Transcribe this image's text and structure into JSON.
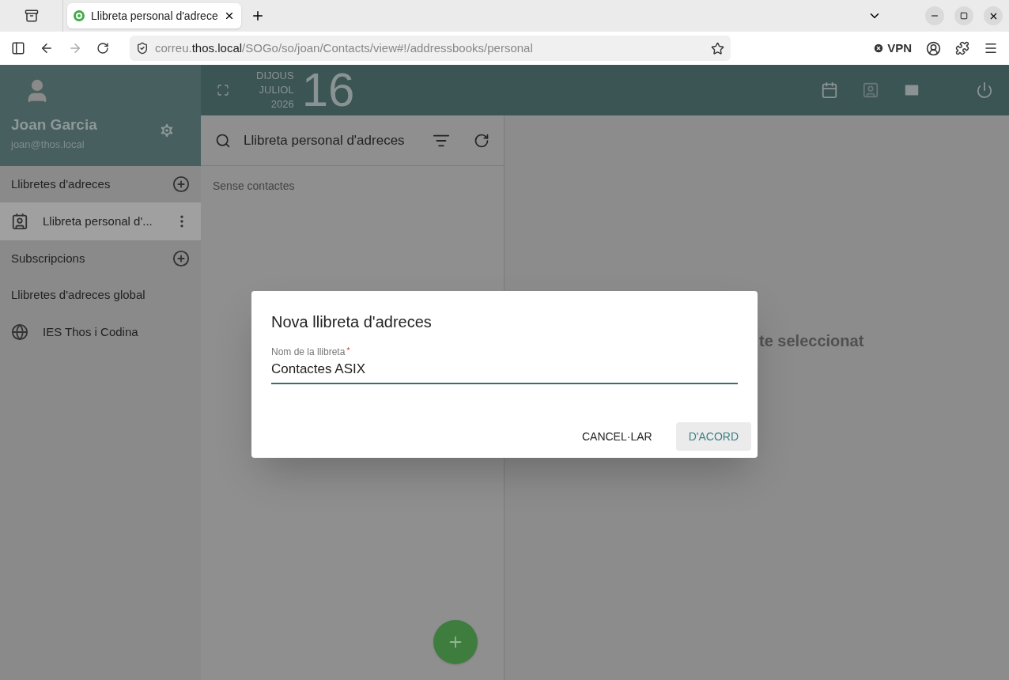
{
  "browser": {
    "tabs": [
      {
        "title": "Llibreta personal d'adrece",
        "selected": true
      }
    ],
    "url": {
      "scheme_host_prefix": "correu.",
      "host": "thos.local",
      "path": "/SOGo/so/joan/Contacts/view#!/addressbooks/personal"
    },
    "vpn": "VPN"
  },
  "user": {
    "name": "Joan Garcia",
    "email": "joan@thos.local"
  },
  "date": {
    "weekday": "DIJOUS",
    "month": "JULIOL",
    "year": "2026",
    "day": "16"
  },
  "sidebar": {
    "items": [
      {
        "kind": "section",
        "label": "Llibretes d'adreces",
        "addable": true
      },
      {
        "kind": "addressbook",
        "label": "Llibreta personal d'...",
        "selected": true
      },
      {
        "kind": "section",
        "label": "Subscripcions",
        "addable": true
      },
      {
        "kind": "section",
        "label": "Llibretes d'adreces global",
        "addable": false
      },
      {
        "kind": "global_addressbook",
        "label": "IES Thos i Codina",
        "selected": false
      }
    ]
  },
  "list": {
    "title": "Llibreta personal d'adreces",
    "empty_text": "Sense contactes"
  },
  "detail": {
    "text": "te seleccionat"
  },
  "dialog": {
    "title": "Nova llibreta d'adreces",
    "field": {
      "label": "Nom de la llibreta",
      "required_marker": "*",
      "value": "Contactes ASIX"
    },
    "buttons": [
      {
        "label": "CANCEL·LAR",
        "kind": "flat"
      },
      {
        "label": "D'ACORD",
        "kind": "primary"
      }
    ]
  }
}
